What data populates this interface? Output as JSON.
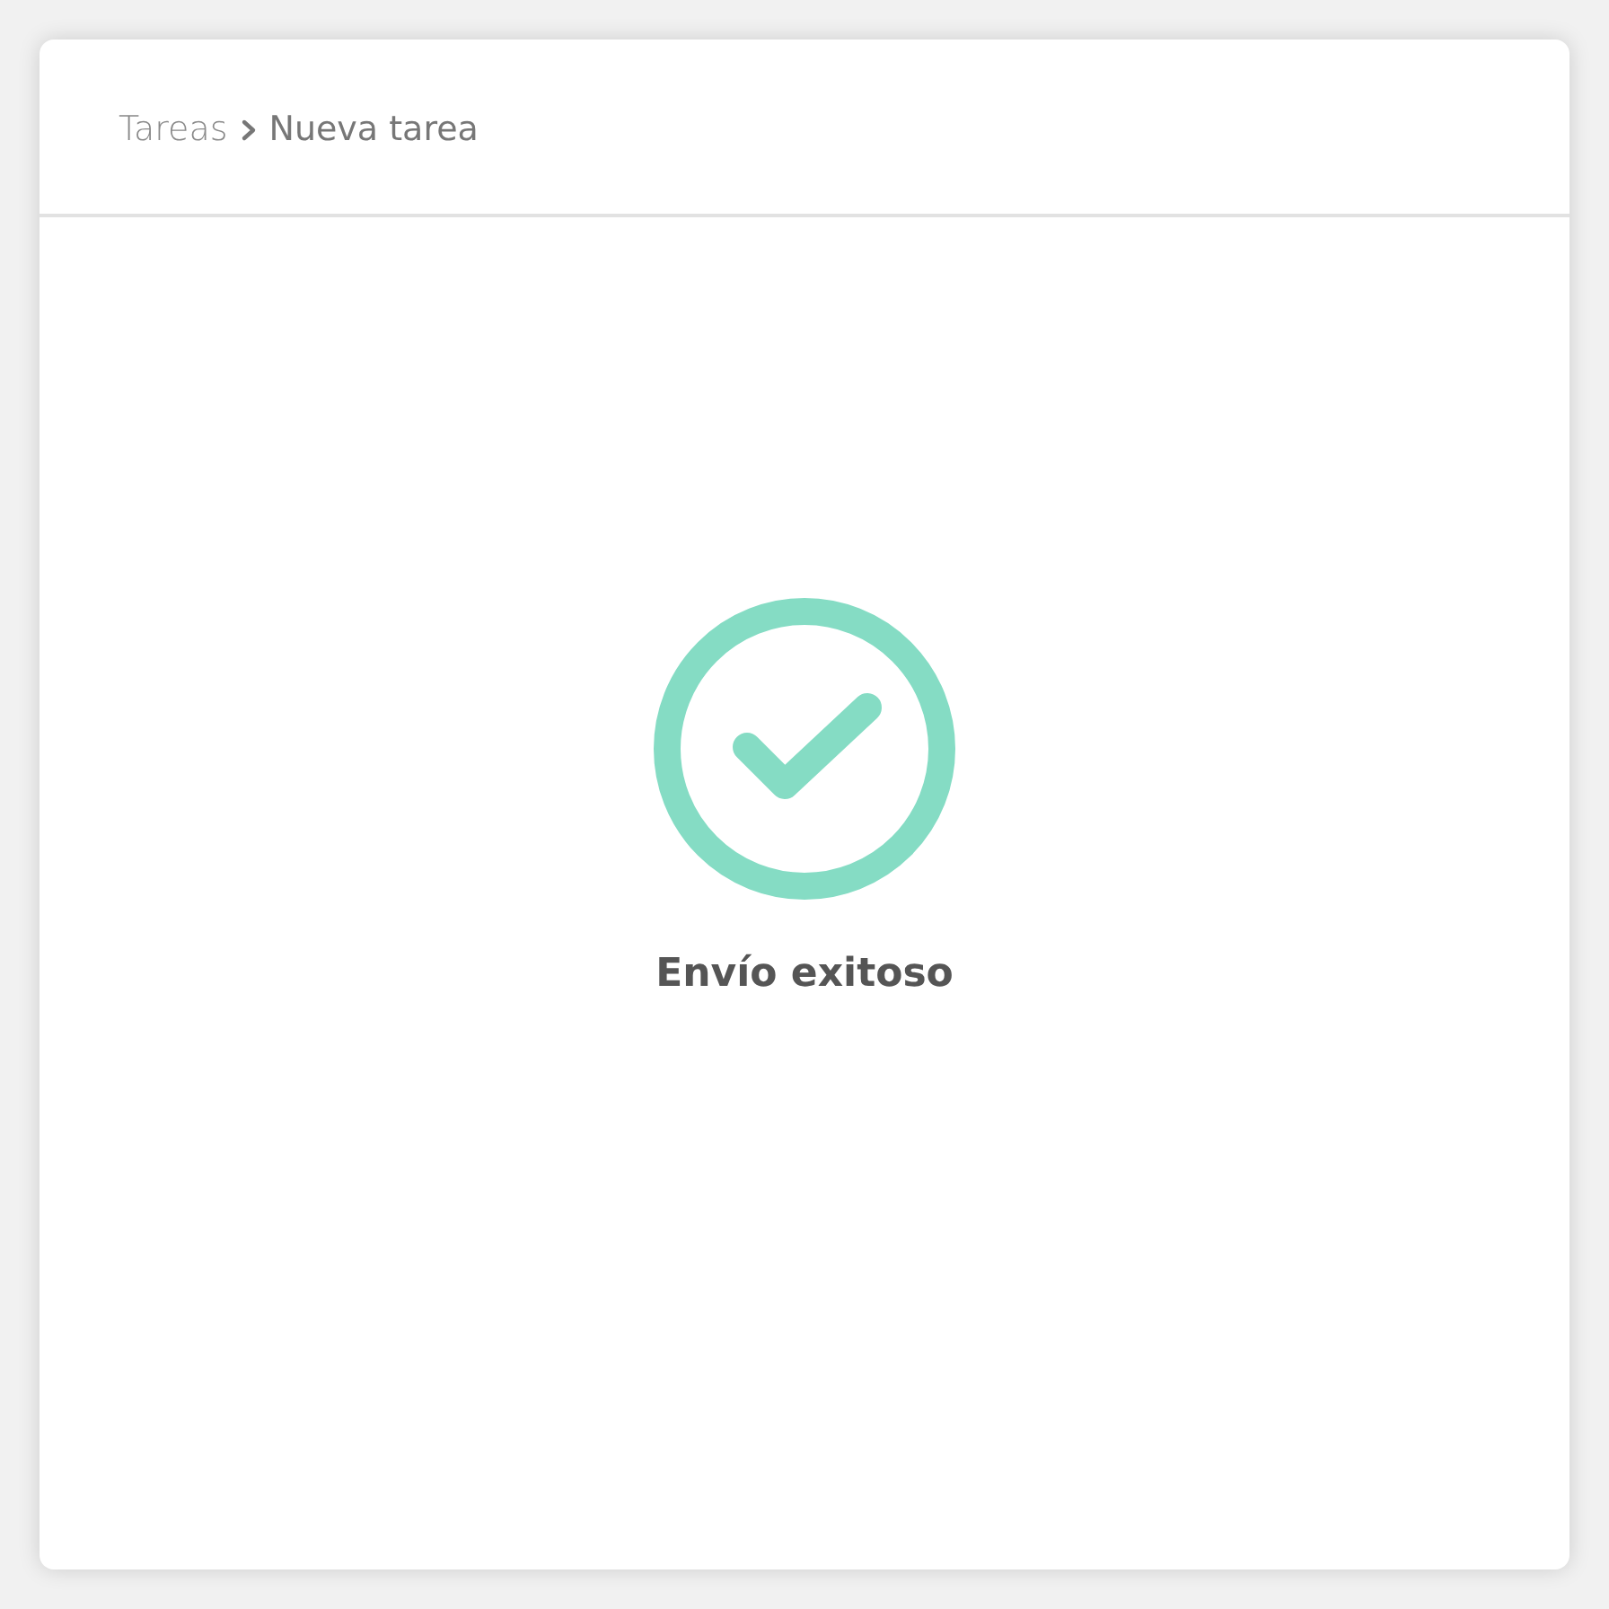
{
  "breadcrumb": [
    {
      "label": "Tareas",
      "selected": false
    },
    {
      "label": "Nueva tarea",
      "selected": true
    }
  ],
  "message": "Envío exitoso"
}
